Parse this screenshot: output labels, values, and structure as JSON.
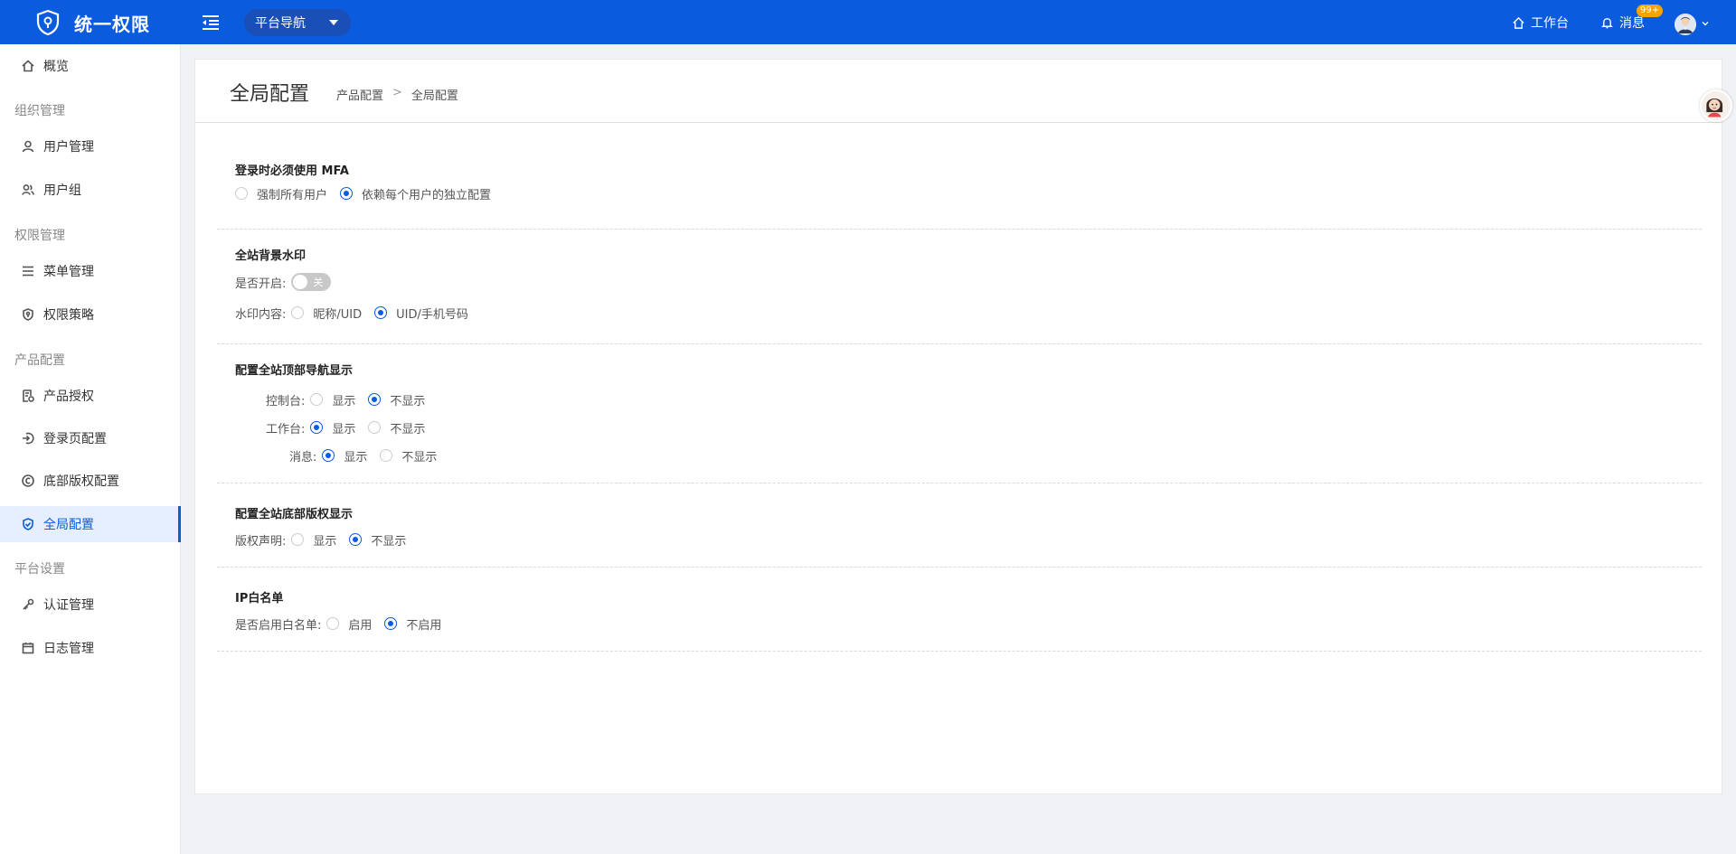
{
  "header": {
    "brand": "统一权限",
    "platform_nav": "平台导航",
    "workbench": "工作台",
    "messages": "消息",
    "badge": "99+"
  },
  "sidebar": {
    "overview": "概览",
    "groups": {
      "org": "组织管理",
      "perm": "权限管理",
      "product": "产品配置",
      "platform": "平台设置"
    },
    "items": {
      "users": "用户管理",
      "user_groups": "用户组",
      "menus": "菜单管理",
      "policies": "权限策略",
      "product_auth": "产品授权",
      "login_page": "登录页配置",
      "footer_copyright": "底部版权配置",
      "global_config": "全局配置",
      "auth_mgmt": "认证管理",
      "log_mgmt": "日志管理"
    }
  },
  "page": {
    "title": "全局配置",
    "breadcrumb": [
      "产品配置",
      ">",
      "全局配置"
    ]
  },
  "sections": {
    "mfa": {
      "title": "登录时必须使用 MFA",
      "opt1": "强制所有用户",
      "opt2": "依赖每个用户的独立配置",
      "selected": "opt2"
    },
    "watermark": {
      "title": "全站背景水印",
      "enable_label": "是否开启:",
      "switch_text": "关",
      "switch_on": false,
      "content_label": "水印内容:",
      "opt1": "昵称/UID",
      "opt2": "UID/手机号码",
      "selected": "opt2"
    },
    "topnav": {
      "title": "配置全站顶部导航显示",
      "console_label": "控制台:",
      "workbench_label": "工作台:",
      "message_label": "消息:",
      "show": "显示",
      "hide": "不显示",
      "console_selected": "hide",
      "workbench_selected": "show",
      "message_selected": "show"
    },
    "footer": {
      "title": "配置全站底部版权显示",
      "label": "版权声明:",
      "show": "显示",
      "hide": "不显示",
      "selected": "hide"
    },
    "ip": {
      "title": "IP白名单",
      "label": "是否启用白名单:",
      "enable": "启用",
      "disable": "不启用",
      "selected": "disable"
    }
  },
  "colors": {
    "primary": "#0a5bdd",
    "badge": "#f7a400"
  }
}
